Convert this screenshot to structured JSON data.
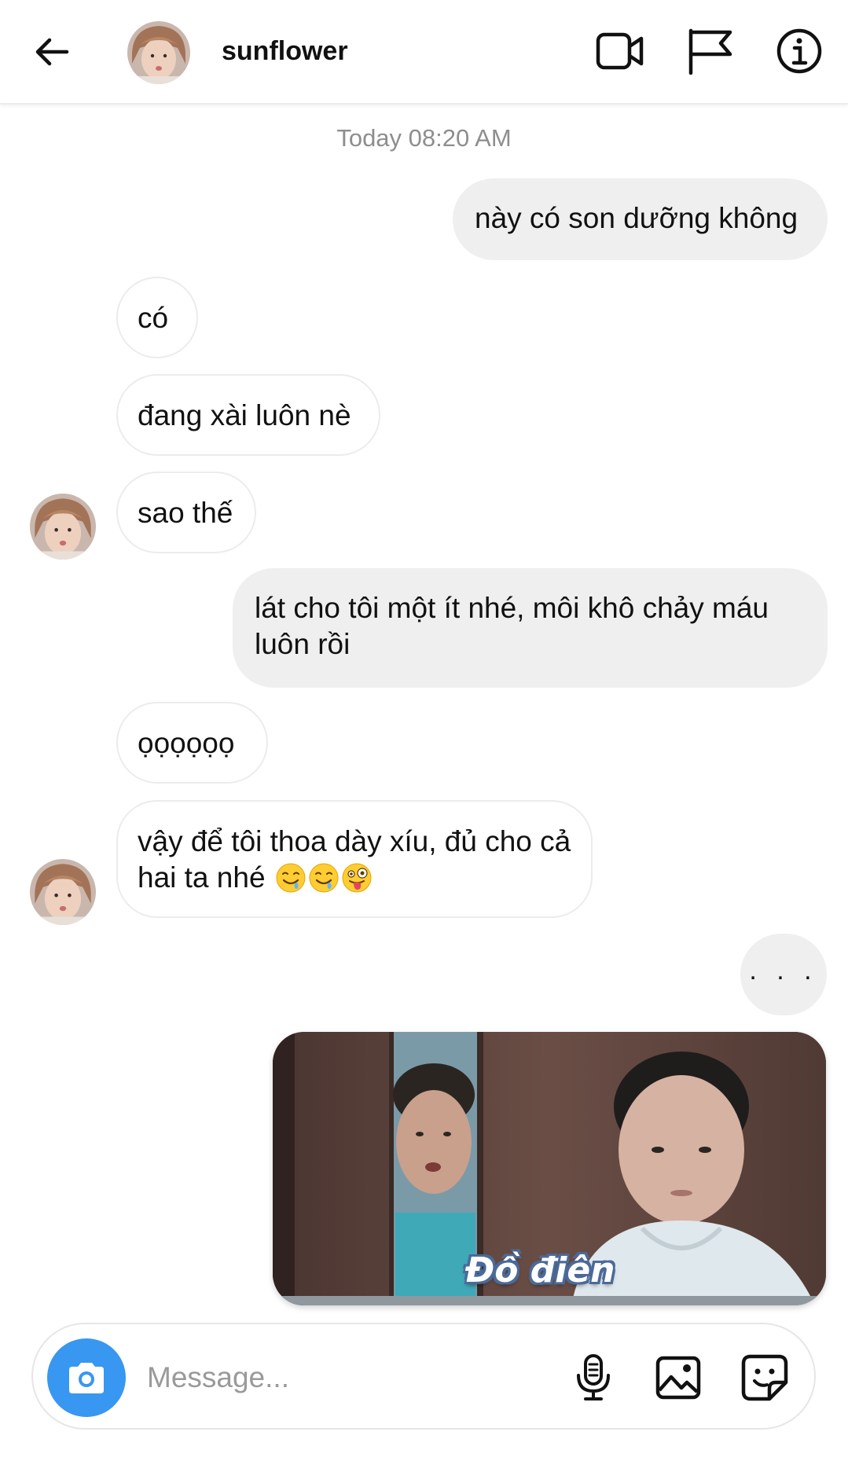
{
  "header": {
    "username": "sunflower",
    "icons": {
      "back": "arrow-left-icon",
      "video": "video-camera-icon",
      "flag": "flag-icon",
      "info": "info-icon"
    }
  },
  "timestamp": "Today 08:20 AM",
  "messages": [
    {
      "direction": "outgoing",
      "text": "này có son dưỡng không"
    },
    {
      "direction": "incoming",
      "text": "có"
    },
    {
      "direction": "incoming",
      "text": "đang xài luôn nè"
    },
    {
      "direction": "incoming",
      "text": "sao thế"
    },
    {
      "direction": "outgoing",
      "text": "lát cho tôi một ít nhé, môi khô chảy máu luôn rồi"
    },
    {
      "direction": "incoming",
      "text": "ọọọọọọ"
    },
    {
      "direction": "incoming",
      "text": "vậy để tôi thoa dày xíu, đủ cho cả hai ta nhé",
      "emojis": [
        "drooling-face-emoji",
        "drooling-face-emoji",
        "winking-tongue-face-emoji"
      ]
    },
    {
      "direction": "outgoing",
      "text": ". . ."
    },
    {
      "direction": "outgoing",
      "type": "gif",
      "caption": "Đồ điên"
    }
  ],
  "composer": {
    "placeholder": "Message...",
    "icons": {
      "camera": "camera-icon",
      "mic": "microphone-icon",
      "gallery": "gallery-icon",
      "sticker": "sticker-icon"
    }
  },
  "colors": {
    "outgoing_bubble": "#efefef",
    "incoming_border": "#ececec",
    "camera_button": "#3897f0",
    "timestamp_text": "#8e8e8e"
  }
}
